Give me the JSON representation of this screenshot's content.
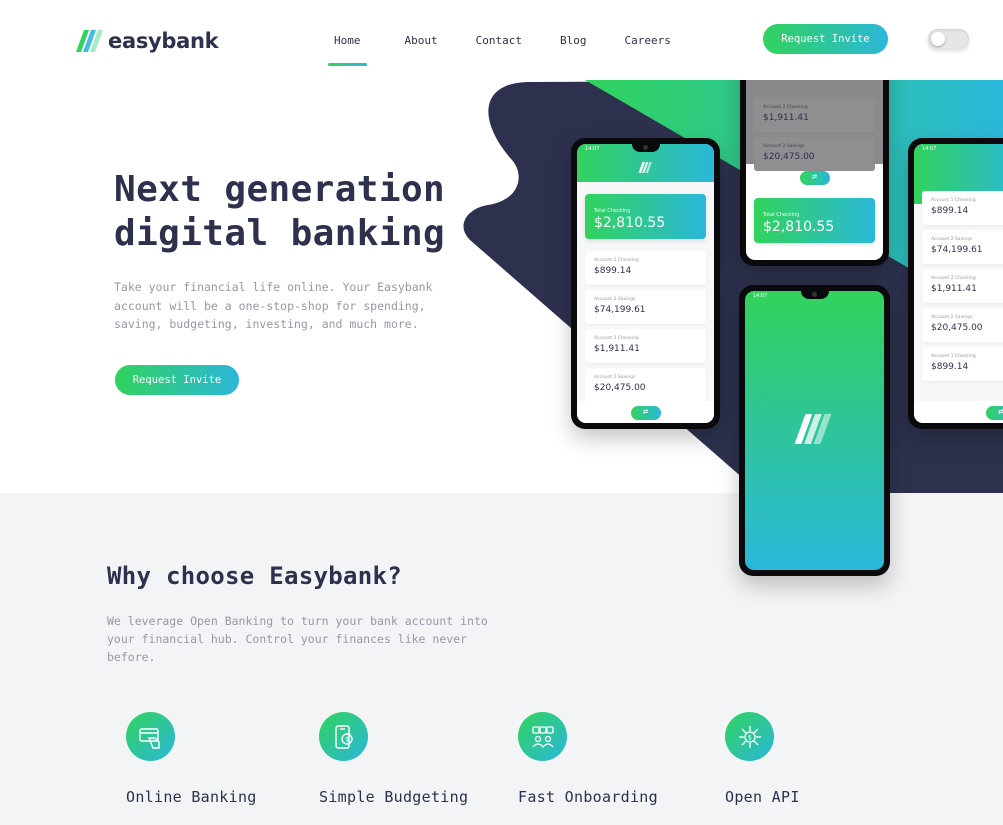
{
  "brand": {
    "name": "easybank",
    "colors": {
      "navy": "#2d314d",
      "green": "#31d35c",
      "cyan": "#2bb7da",
      "grayText": "#9698a6",
      "lightBg": "#f3f4f6"
    }
  },
  "nav": {
    "items": [
      {
        "label": "Home",
        "active": true
      },
      {
        "label": "About"
      },
      {
        "label": "Contact"
      },
      {
        "label": "Blog"
      },
      {
        "label": "Careers"
      }
    ],
    "cta_label": "Request Invite",
    "theme_toggle": {
      "icon": "toggle-switch-icon",
      "state": "off"
    }
  },
  "hero": {
    "title_line1": "Next generation",
    "title_line2": "digital banking",
    "description": "Take your financial life online. Your Easybank account will be a one-stop-shop for spending, saving, budgeting, investing, and much more.",
    "cta_label": "Request Invite"
  },
  "phones": {
    "status_time": "14:07",
    "total_label": "Total Checking",
    "total_value": "$2,810.55",
    "accounts": [
      {
        "label": "Account 1 Checking",
        "value": "$899.14"
      },
      {
        "label": "Account 2 Savings",
        "value": "$74,199.61"
      },
      {
        "label": "Account 2 Checking",
        "value": "$1,911.41"
      },
      {
        "label": "Account 2 Savings",
        "value": "$20,475.00"
      },
      {
        "label": "Account 1 Checking",
        "value": "$899.14"
      }
    ],
    "fab_icon": "transfer-icon",
    "fab_symbol": "⇄"
  },
  "why": {
    "title": "Why choose Easybank?",
    "description": "We leverage Open Banking to turn your bank account into your financial hub. Control your finances like never before.",
    "features": [
      {
        "title": "Online Banking",
        "icon": "online-banking-icon"
      },
      {
        "title": "Simple Budgeting",
        "icon": "simple-budgeting-icon"
      },
      {
        "title": "Fast Onboarding",
        "icon": "fast-onboarding-icon"
      },
      {
        "title": "Open API",
        "icon": "open-api-icon"
      }
    ]
  }
}
